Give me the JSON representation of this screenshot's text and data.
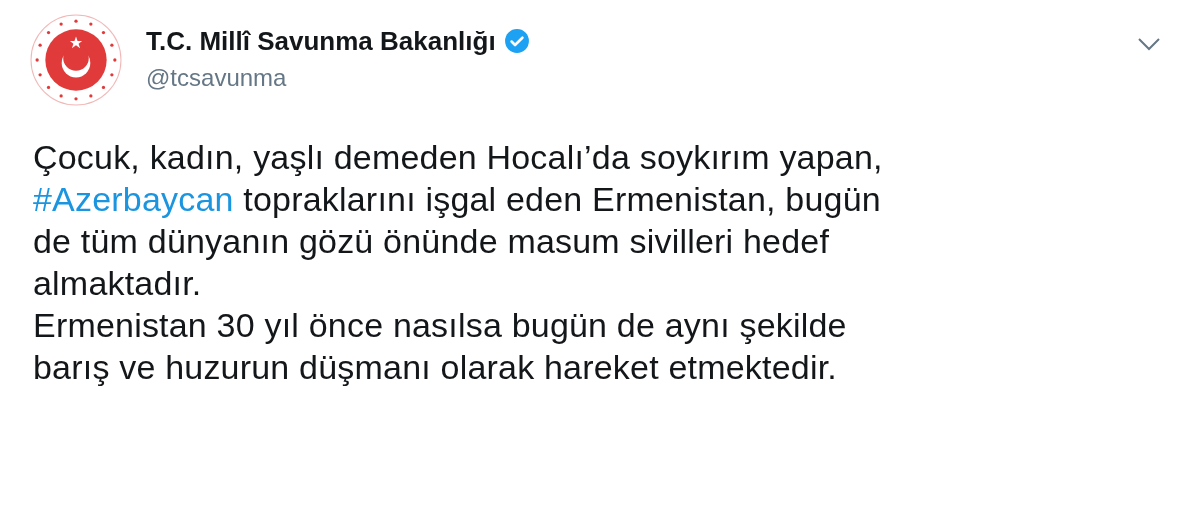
{
  "author": {
    "name": "T.C. Millî Savunma Bakanlığı",
    "handle": "@tcsavunma",
    "verified": true
  },
  "tweet": {
    "paragraphs": [
      {
        "parts": [
          {
            "kind": "text",
            "text": "Çocuk, kadın, yaşlı demeden Hocalı’da soykırım yapan,\n"
          },
          {
            "kind": "hashtag",
            "text": "#Azerbaycan"
          },
          {
            "kind": "text",
            "text": " topraklarını işgal eden Ermenistan, bugün\nde tüm dünyanın gözü önünde masum sivilleri hedef\nalmaktadır."
          }
        ]
      },
      {
        "parts": [
          {
            "kind": "text",
            "text": "Ermenistan 30 yıl önce nasılsa bugün de aynı şekilde\nbarış ve huzurun düşmanı olarak hareket etmektedir."
          }
        ]
      }
    ]
  }
}
